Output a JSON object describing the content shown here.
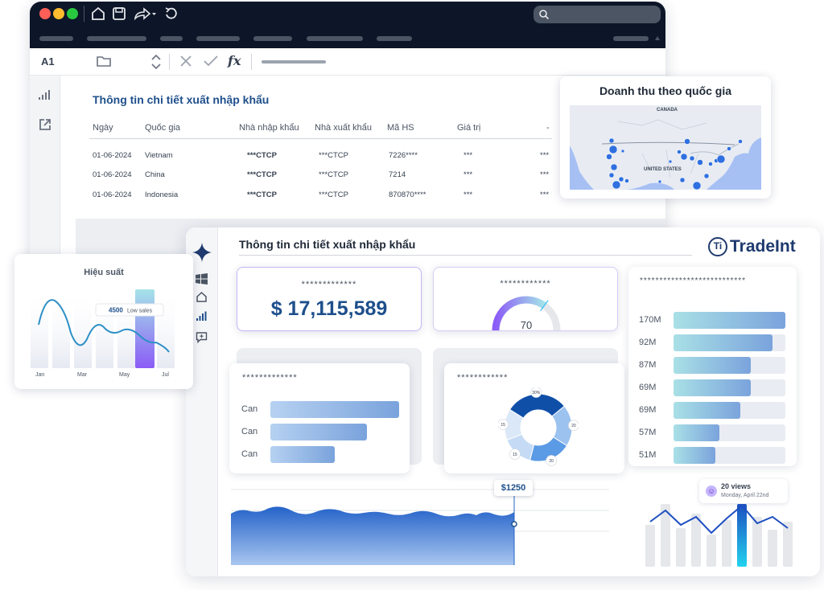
{
  "back_window": {
    "cell_ref": "A1",
    "title": "Thông tin chi tiết xuất nhập khẩu",
    "columns": [
      "Ngày",
      "Quốc gia",
      "Nhà nhập khẩu",
      "Nhà xuất khẩu",
      "Mã HS",
      "Giá trị",
      "-"
    ],
    "rows": [
      [
        "01-06-2024",
        "Vietnam",
        "***CTCP",
        "***CTCP",
        "7226****",
        "***",
        "***"
      ],
      [
        "01-06-2024",
        "China",
        "***CTCP",
        "***CTCP",
        "7214",
        "***",
        "***"
      ],
      [
        "01-06-2024",
        "Indonesia",
        "***CTCP",
        "***CTCP",
        "870870****",
        "***",
        "***"
      ]
    ]
  },
  "map_card": {
    "title": "Doanh thu theo quốc gia",
    "label_canada": "CANADA",
    "label_us": "UNITED STATES"
  },
  "left_card": {
    "title": "Hiệu suất",
    "tooltip_value": "4500",
    "tooltip_text": "Low sales",
    "x_labels": [
      "Jan",
      "Mar",
      "May",
      "Jul"
    ]
  },
  "dashboard": {
    "title": "Thông tin chi tiết xuất nhập khẩu",
    "brand": "TradeInt",
    "brand_mark": "Ti",
    "kpi_money_label": "*************",
    "kpi_money_value": "$ 17,115,589",
    "gauge_label": "************",
    "gauge_value": "70",
    "gauge_level": 0.7,
    "country_bars_label": "*************",
    "country_bars": [
      {
        "label": "Can",
        "value": 1.0
      },
      {
        "label": "Can",
        "value": 0.75
      },
      {
        "label": "Can",
        "value": 0.5
      }
    ],
    "donut_label": "************",
    "donut_slices": [
      {
        "label": "30%",
        "value": 30,
        "color": "#0f4fa8"
      },
      {
        "label": "20",
        "value": 20,
        "color": "#9cc2ef"
      },
      {
        "label": "20",
        "value": 20,
        "color": "#5b9ae4"
      },
      {
        "label": "15",
        "value": 15,
        "color": "#c5dbf5"
      },
      {
        "label": "15",
        "value": 15,
        "color": "#dbe8f8"
      }
    ],
    "ranking_label": "***************************",
    "ranking": [
      {
        "label": "170M",
        "value": 170
      },
      {
        "label": "92M",
        "value": 150
      },
      {
        "label": "87M",
        "value": 118
      },
      {
        "label": "69M",
        "value": 118
      },
      {
        "label": "69M",
        "value": 101
      },
      {
        "label": "57M",
        "value": 70
      },
      {
        "label": "51M",
        "value": 64
      }
    ],
    "area_tooltip": "$1250",
    "views_text": "20 views",
    "views_date": "Monday, April 22nd"
  },
  "colors": {
    "titlebar": "#0d1628",
    "accent": "#1e4f8c",
    "brand": "#1e3a6e"
  }
}
